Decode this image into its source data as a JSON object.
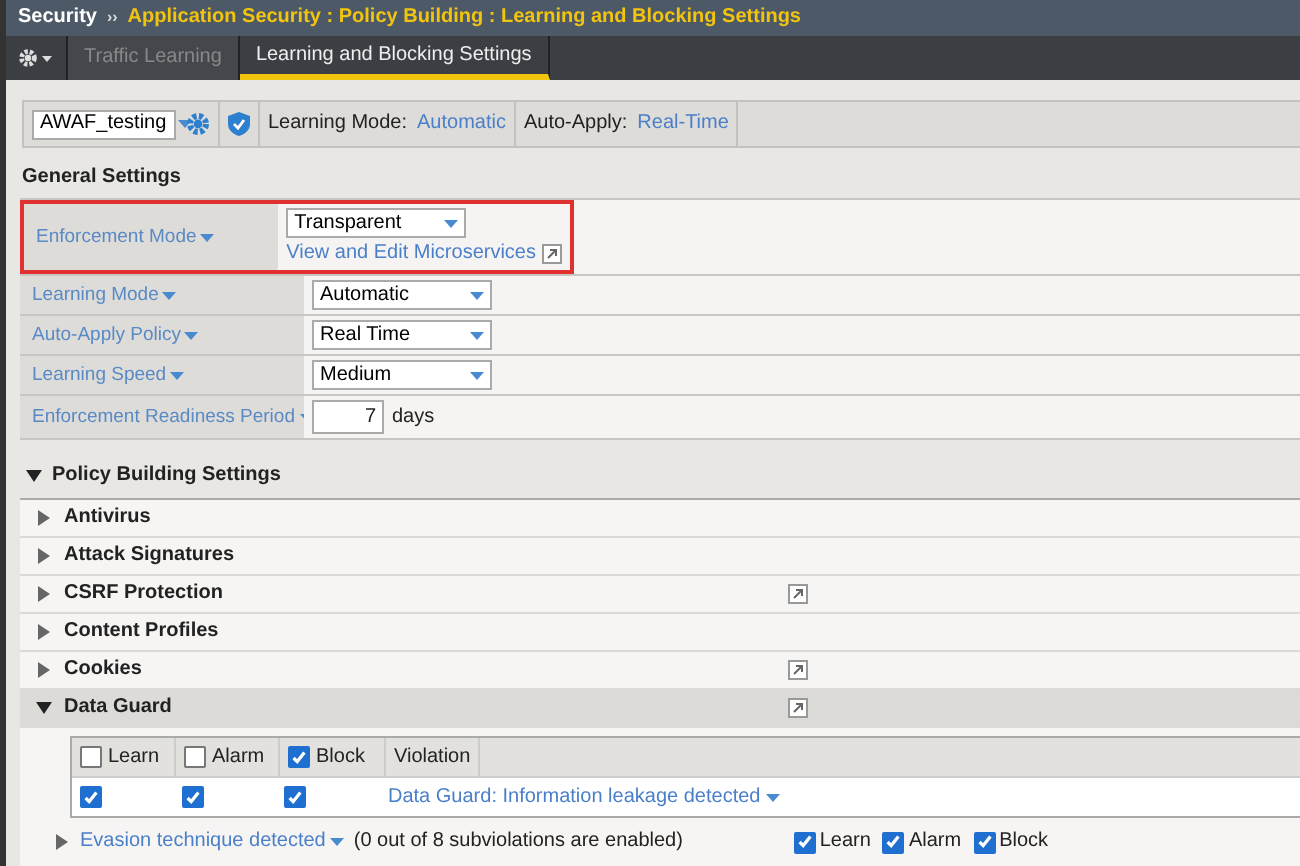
{
  "breadcrumb": {
    "root": "Security",
    "separator": "››",
    "path": "Application Security : Policy Building : Learning and Blocking Settings"
  },
  "tabs": [
    {
      "label": "Traffic Learning",
      "selected": false
    },
    {
      "label": "Learning and Blocking Settings",
      "selected": true
    }
  ],
  "toolbar": {
    "policy": "AWAF_testing",
    "learning_mode_label": "Learning Mode:",
    "learning_mode": "Automatic",
    "auto_apply_label": "Auto-Apply:",
    "auto_apply": "Real-Time"
  },
  "general_settings": {
    "title": "General Settings",
    "rows": [
      {
        "label": "Enforcement Mode",
        "kind": "select",
        "value": "Transparent",
        "link": "View and Edit Microservices",
        "highlighted": true
      },
      {
        "label": "Learning Mode",
        "kind": "select",
        "value": "Automatic",
        "highlighted": false
      },
      {
        "label": "Auto-Apply Policy",
        "kind": "select",
        "value": "Real Time",
        "highlighted": false
      },
      {
        "label": "Learning Speed",
        "kind": "select",
        "value": "Medium",
        "highlighted": false
      },
      {
        "label": "Enforcement Readiness Period",
        "kind": "number",
        "value": "7",
        "unit": "days",
        "highlighted": false
      }
    ]
  },
  "policy_building": {
    "title": "Policy Building Settings",
    "expanded": true,
    "sections": [
      {
        "label": "Antivirus",
        "expanded": false,
        "popout": false
      },
      {
        "label": "Attack Signatures",
        "expanded": false,
        "popout": false
      },
      {
        "label": "CSRF Protection",
        "expanded": false,
        "popout": true
      },
      {
        "label": "Content Profiles",
        "expanded": false,
        "popout": false
      },
      {
        "label": "Cookies",
        "expanded": false,
        "popout": true
      },
      {
        "label": "Data Guard",
        "expanded": true,
        "popout": true
      }
    ]
  },
  "data_guard": {
    "columns": [
      {
        "label": "Learn",
        "kind": "check",
        "checked": false
      },
      {
        "label": "Alarm",
        "kind": "check",
        "checked": false
      },
      {
        "label": "Block",
        "kind": "check",
        "checked": true
      },
      {
        "label": "Violation",
        "kind": "text"
      }
    ],
    "rows": [
      {
        "learn": true,
        "alarm": true,
        "block": true,
        "violation": "Data Guard: Information leakage detected"
      }
    ]
  },
  "evasion": {
    "label": "Evasion technique detected",
    "note": "(0 out of 8 subviolations are enabled)",
    "expanded": false,
    "flags": [
      {
        "label": "Learn",
        "checked": true
      },
      {
        "label": "Alarm",
        "checked": true
      },
      {
        "label": "Block",
        "checked": true
      }
    ]
  }
}
